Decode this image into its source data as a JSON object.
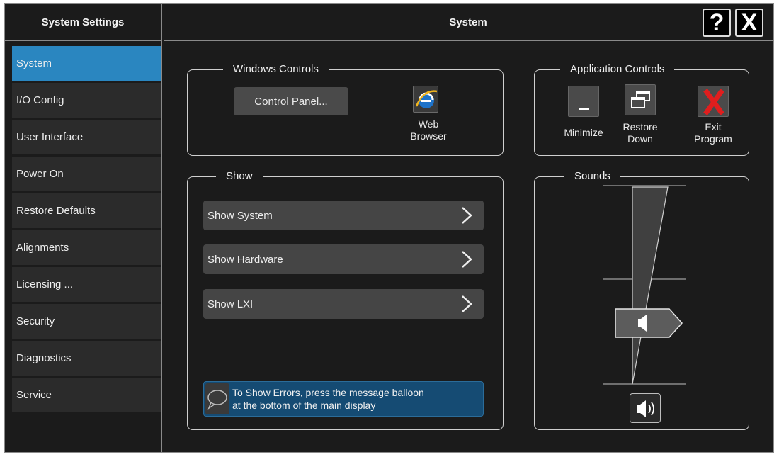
{
  "left": {
    "title": "System Settings",
    "items": [
      {
        "label": "System",
        "active": true
      },
      {
        "label": "I/O Config"
      },
      {
        "label": "User Interface"
      },
      {
        "label": "Power On"
      },
      {
        "label": "Restore Defaults"
      },
      {
        "label": "Alignments"
      },
      {
        "label": "Licensing ..."
      },
      {
        "label": "Security"
      },
      {
        "label": "Diagnostics"
      },
      {
        "label": "Service"
      }
    ]
  },
  "main": {
    "title": "System",
    "help_label": "?",
    "close_label": "X"
  },
  "windows_controls": {
    "legend": "Windows Controls",
    "control_panel": "Control Panel...",
    "web_browser_line1": "Web",
    "web_browser_line2": "Browser"
  },
  "application_controls": {
    "legend": "Application Controls",
    "minimize": "Minimize",
    "restore_line1": "Restore",
    "restore_line2": "Down",
    "exit_line1": "Exit",
    "exit_line2": "Program"
  },
  "show": {
    "legend": "Show",
    "items": [
      "Show System",
      "Show Hardware",
      "Show LXI"
    ],
    "error_line1": "To Show Errors, press the message balloon",
    "error_line2": "at the bottom of the main display"
  },
  "sounds": {
    "legend": "Sounds",
    "volume_level": 0.45
  },
  "colors": {
    "accent": "#2a86c0",
    "panel_bg": "#1b1b1b",
    "button_bg": "#454545",
    "info_bg": "#154b73",
    "exit_red": "#d81e1e"
  }
}
